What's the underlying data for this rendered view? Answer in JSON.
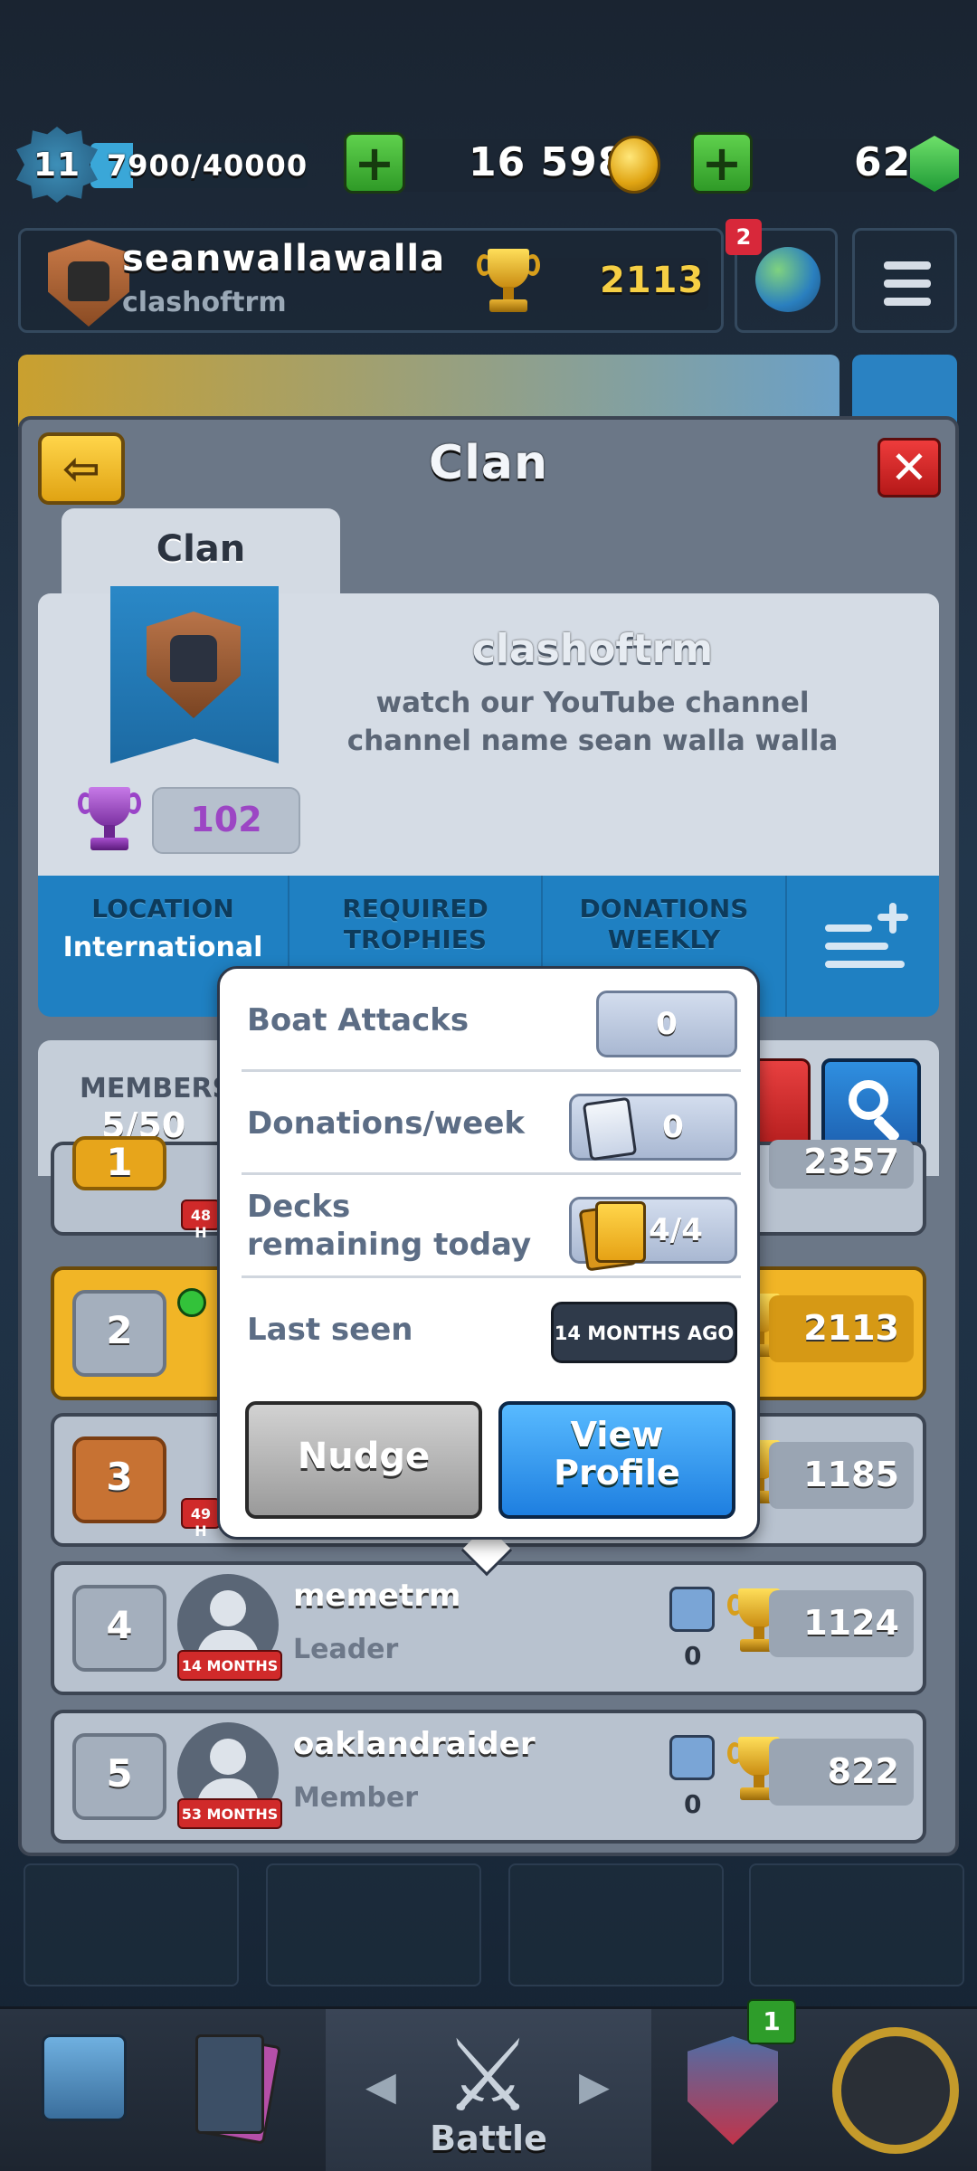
{
  "top_bar": {
    "level": "11",
    "xp": "7900/40000",
    "xp_fraction": 0.1975,
    "gold": "16 598",
    "gems": "62"
  },
  "profile": {
    "name": "seanwallawalla",
    "clan": "clashoftrm",
    "trophies": "2113",
    "notification_count": "2"
  },
  "panel": {
    "title": "Clan",
    "tab_label": "Clan"
  },
  "clan_info": {
    "name": "clashoftrm",
    "description": "watch our YouTube channel channel name sean walla walla",
    "trophies": "102",
    "stats": [
      {
        "label": "LOCATION",
        "value": "International"
      },
      {
        "label": "REQUIRED TROPHIES",
        "value": ""
      },
      {
        "label": "DONATIONS WEEKLY",
        "value": ""
      }
    ]
  },
  "members_bar": {
    "label": "MEMBERS",
    "count": "5/50"
  },
  "members": [
    {
      "rank": "1",
      "name": "",
      "role": "",
      "last_seen": "48 H",
      "donations": "",
      "trophies": "2357"
    },
    {
      "rank": "2",
      "name": "",
      "role": "",
      "last_seen": "",
      "donations": "",
      "trophies": "2113"
    },
    {
      "rank": "3",
      "name": "",
      "role": "",
      "last_seen": "49 H",
      "donations": "",
      "trophies": "1185"
    },
    {
      "rank": "4",
      "name": "memetrm",
      "role": "Leader",
      "last_seen": "14 MONTHS",
      "donations": "0",
      "trophies": "1124"
    },
    {
      "rank": "5",
      "name": "oaklandraider",
      "role": "Member",
      "last_seen": "53 MONTHS",
      "donations": "0",
      "trophies": "822"
    }
  ],
  "popup": {
    "rows": [
      {
        "label": "Boat Attacks",
        "value": "0"
      },
      {
        "label": "Donations/week",
        "value": "0"
      },
      {
        "label": "Decks remaining today",
        "value": "4/4"
      },
      {
        "label": "Last seen",
        "value": "14 MONTHS AGO"
      }
    ],
    "nudge_label": "Nudge",
    "view_profile_label": "View Profile"
  },
  "bottom_nav": {
    "battle_label": "Battle",
    "clan_badge": "1"
  },
  "colors": {
    "gold_row": "#f1b526",
    "blue_button": "#1e7fe0",
    "stats_band": "#1f80c2",
    "red_tag": "#d02a2a"
  }
}
